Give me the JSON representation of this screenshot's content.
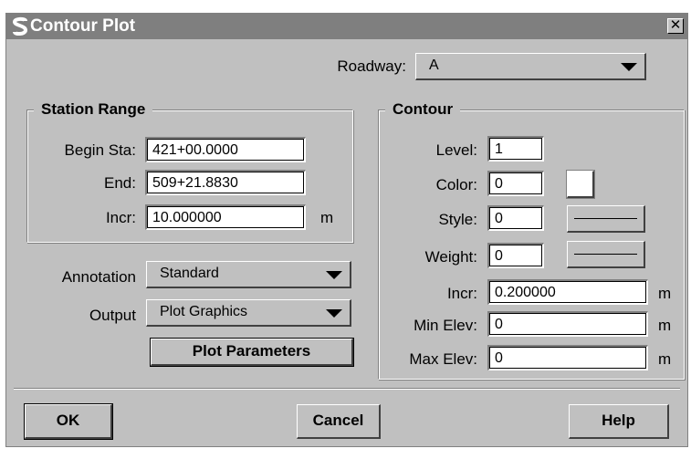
{
  "window": {
    "title": "Contour Plot",
    "close_glyph": "✕"
  },
  "roadway": {
    "label": "Roadway:",
    "value": "A"
  },
  "station_range": {
    "title": "Station Range",
    "begin_label": "Begin Sta:",
    "begin_value": "421+00.0000",
    "end_label": "End:",
    "end_value": "509+21.8830",
    "incr_label": "Incr:",
    "incr_value": "10.000000",
    "incr_unit": "m"
  },
  "annotation": {
    "label": "Annotation",
    "value": "Standard"
  },
  "output": {
    "label": "Output",
    "value": "Plot Graphics"
  },
  "plot_parameters_label": "Plot Parameters",
  "contour": {
    "title": "Contour",
    "level_label": "Level:",
    "level_value": "1",
    "color_label": "Color:",
    "color_value": "0",
    "color_swatch": "#ffffff",
    "style_label": "Style:",
    "style_value": "0",
    "weight_label": "Weight:",
    "weight_value": "0",
    "incr_label": "Incr:",
    "incr_value": "0.200000",
    "incr_unit": "m",
    "min_elev_label": "Min Elev:",
    "min_elev_value": "0",
    "min_elev_unit": "m",
    "max_elev_label": "Max Elev:",
    "max_elev_value": "0",
    "max_elev_unit": "m"
  },
  "buttons": {
    "ok": "OK",
    "cancel": "Cancel",
    "help": "Help"
  },
  "colors": {
    "title_bar": "#7f7f7f",
    "dialog_bg": "#c0c0c0",
    "icon_color": "#ffffff"
  },
  "icons": {
    "app": "geopak-s-icon",
    "close": "close-icon",
    "dropdown": "chevron-down-icon"
  }
}
